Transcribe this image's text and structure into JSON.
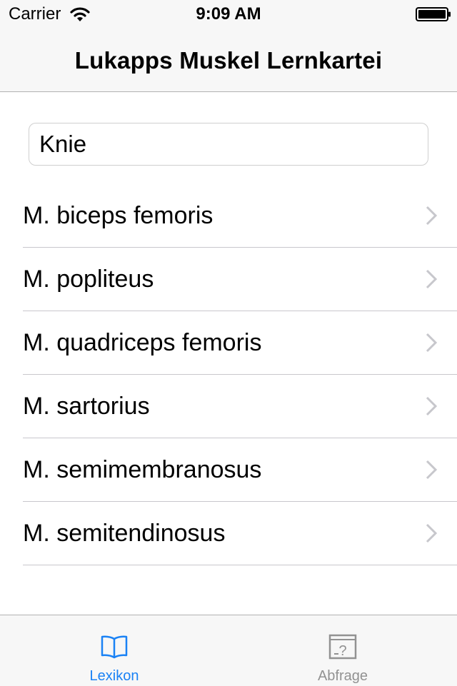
{
  "status_bar": {
    "carrier": "Carrier",
    "time": "9:09 AM",
    "icons": [
      "wifi-icon",
      "battery-icon"
    ]
  },
  "nav": {
    "title": "Lukapps Muskel Lernkartei"
  },
  "search": {
    "value": "Knie"
  },
  "list": {
    "items": [
      {
        "label": "M. biceps femoris"
      },
      {
        "label": "M. popliteus"
      },
      {
        "label": "M. quadriceps femoris"
      },
      {
        "label": "M. sartorius"
      },
      {
        "label": "M. semimembranosus"
      },
      {
        "label": "M. semitendinosus"
      }
    ]
  },
  "tabbar": {
    "tabs": [
      {
        "label": "Lexikon",
        "icon": "book-icon",
        "active": true
      },
      {
        "label": "Abfrage",
        "icon": "quiz-card-icon",
        "active": false
      }
    ]
  },
  "colors": {
    "accent": "#1a82f5",
    "inactive": "#929292",
    "bar_background": "#f7f7f7",
    "separator": "#c8c7cc",
    "chevron": "#c7c7cc"
  }
}
